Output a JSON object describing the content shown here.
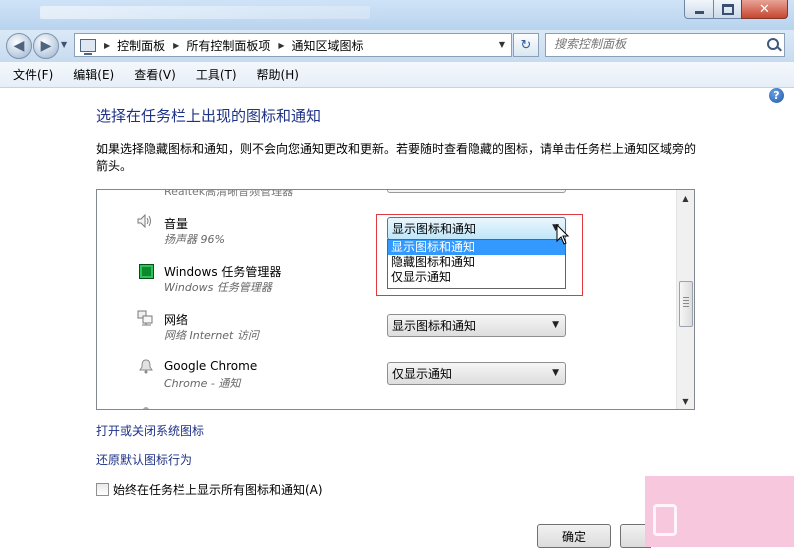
{
  "window": {
    "min_icon": "minimize-icon",
    "max_icon": "maximize-icon",
    "close_icon": "close-icon",
    "close_glyph": "✕"
  },
  "nav": {
    "back_glyph": "◀",
    "forward_glyph": "▶",
    "breadcrumb": [
      "控制面板",
      "所有控制面板项",
      "通知区域图标"
    ],
    "refresh_glyph": "↻",
    "search_placeholder": "搜索控制面板"
  },
  "menu": [
    "文件(F)",
    "编辑(E)",
    "查看(V)",
    "工具(T)",
    "帮助(H)"
  ],
  "help_glyph": "?",
  "heading": "选择在任务栏上出现的图标和通知",
  "description": "如果选择隐藏图标和通知，则不会向您通知更改和更新。若要随时查看隐藏的图标，请单击任务栏上通知区域旁的箭头。",
  "list": {
    "clipped_top_text": "Realtek高清晰音频管理器",
    "rows": [
      {
        "title": "音量",
        "subtitle": "扬声器 96%",
        "behavior": "显示图标和通知",
        "icon": "speaker-icon"
      },
      {
        "title": "Windows 任务管理器",
        "subtitle": "Windows 任务管理器",
        "behavior": "",
        "icon": "task-manager-icon"
      },
      {
        "title": "网络",
        "subtitle": "网络 Internet 访问",
        "behavior": "显示图标和通知",
        "icon": "network-icon"
      },
      {
        "title": "Google Chrome",
        "subtitle": "Chrome - 通知",
        "behavior": "仅显示通知",
        "icon": "bell-icon"
      }
    ],
    "dropdown_options": [
      "显示图标和通知",
      "隐藏图标和通知",
      "仅显示通知"
    ],
    "dropdown_selected_index": 0
  },
  "links": {
    "system_icons": "打开或关闭系统图标",
    "restore_defaults": "还原默认图标行为"
  },
  "always_show": {
    "label": "始终在任务栏上显示所有图标和通知(A)",
    "checked": false
  },
  "buttons": {
    "ok": "确定"
  },
  "colors": {
    "heading": "#1e3287",
    "highlight_box": "#e0393e",
    "selection": "#3399ff"
  }
}
